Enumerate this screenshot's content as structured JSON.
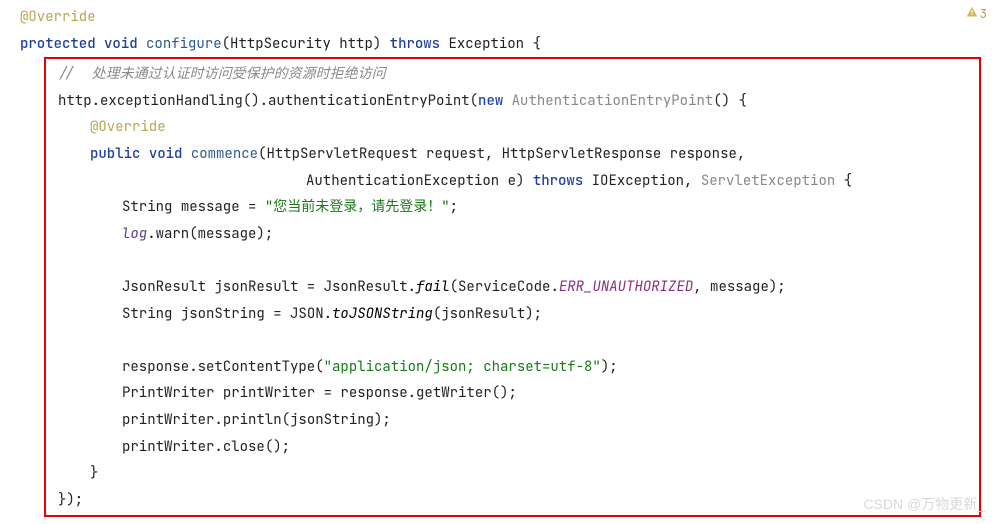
{
  "badge": {
    "warning_count": "3"
  },
  "code": {
    "line1": {
      "annotation": "@Override"
    },
    "line2": {
      "kw_protected": "protected",
      "kw_void": "void",
      "method": "configure",
      "p_open": "(",
      "type_http": "HttpSecurity",
      "param_http": " http",
      "p_close": ") ",
      "kw_throws": "throws",
      "type_ex": " Exception ",
      "brace": "{"
    },
    "line3": {
      "comment": "//  处理未通过认证时访问受保护的资源时拒绝访问"
    },
    "line4": {
      "obj": "http",
      "dot1": ".",
      "m1": "exceptionHandling",
      "p1": "().",
      "m2": "authenticationEntryPoint",
      "p2": "(",
      "kw_new": "new",
      "sp": " ",
      "type": "AuthenticationEntryPoint",
      "p3": "() {"
    },
    "line5": {
      "annotation": "@Override"
    },
    "line6": {
      "kw_public": "public",
      "sp1": " ",
      "kw_void": "void",
      "sp2": " ",
      "method": "commence",
      "p_open": "(",
      "t1": "HttpServletRequest",
      "a1": " request",
      "c1": ", ",
      "t2": "HttpServletResponse",
      "a2": " response",
      "c2": ","
    },
    "line7": {
      "t3": "AuthenticationException",
      "a3": " e",
      "p_close": ") ",
      "kw_throws": "throws",
      "sp": " ",
      "t4": "IOException",
      "c": ", ",
      "t5": "ServletException",
      "brace": " {"
    },
    "line8": {
      "type": "String ",
      "var": "message",
      "eq": " = ",
      "str": "\"您当前未登录，请先登录！\"",
      "semi": ";"
    },
    "line9": {
      "obj": "log",
      "dot": ".",
      "m": "warn",
      "args": "(message);"
    },
    "line10": {
      "type": "JsonResult ",
      "var": "jsonResult",
      "eq": " = ",
      "cls": "JsonResult",
      "dot": ".",
      "m": "fail",
      "po": "(",
      "sc": "ServiceCode",
      "dot2": ".",
      "field": "ERR_UNAUTHORIZED",
      "rest": ", message);"
    },
    "line11": {
      "type": "String ",
      "var": "jsonString",
      "eq": " = ",
      "cls": "JSON",
      "dot": ".",
      "m": "toJSONString",
      "args": "(jsonResult);"
    },
    "line12": {
      "obj": "response",
      "dot": ".",
      "m": "setContentType",
      "po": "(",
      "str": "\"application/json; charset=utf-8\"",
      "pc": ");"
    },
    "line13": {
      "type": "PrintWriter ",
      "var": "printWriter",
      "eq": " = ",
      "obj": "response",
      "dot": ".",
      "m": "getWriter",
      "args": "();"
    },
    "line14": {
      "obj": "printWriter",
      "dot": ".",
      "m": "println",
      "args": "(jsonString);"
    },
    "line15": {
      "obj": "printWriter",
      "dot": ".",
      "m": "close",
      "args": "();"
    },
    "line16": {
      "brace": "}"
    },
    "line17": {
      "brace": "});"
    }
  },
  "watermark": "CSDN @万物更新_"
}
